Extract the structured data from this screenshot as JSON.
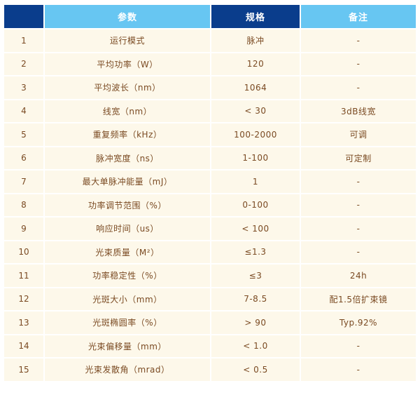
{
  "table": {
    "headers": [
      "",
      "参数",
      "规格",
      "备注"
    ],
    "rows": [
      {
        "idx": "1",
        "param": "运行模式",
        "spec": "脉冲",
        "note": "-"
      },
      {
        "idx": "2",
        "param": "平均功率（W）",
        "spec": "120",
        "note": "-"
      },
      {
        "idx": "3",
        "param": "平均波长（nm）",
        "spec": "1064",
        "note": "-"
      },
      {
        "idx": "4",
        "param": "线宽（nm）",
        "spec": "< 30",
        "note": "3dB线宽"
      },
      {
        "idx": "5",
        "param": "重复频率（kHz）",
        "spec": "100-2000",
        "note": "可调"
      },
      {
        "idx": "6",
        "param": "脉冲宽度（ns）",
        "spec": "1-100",
        "note": "可定制"
      },
      {
        "idx": "7",
        "param": "最大单脉冲能量（mJ）",
        "spec": "1",
        "note": "-"
      },
      {
        "idx": "8",
        "param": "功率调节范围（%）",
        "spec": "0-100",
        "note": "-"
      },
      {
        "idx": "9",
        "param": "响应时间（us）",
        "spec": "< 100",
        "note": "-"
      },
      {
        "idx": "10",
        "param": "光束质量（M²）",
        "spec": "≤1.3",
        "note": "-"
      },
      {
        "idx": "11",
        "param": "功率稳定性（%）",
        "spec": "≤3",
        "note": "24h"
      },
      {
        "idx": "12",
        "param": "光斑大小（mm）",
        "spec": "7-8.5",
        "note": "配1.5倍扩束镜"
      },
      {
        "idx": "13",
        "param": "光斑椭圆率（%）",
        "spec": "> 90",
        "note": "Typ.92%"
      },
      {
        "idx": "14",
        "param": "光束偏移量（mm）",
        "spec": "< 1.0",
        "note": "-"
      },
      {
        "idx": "15",
        "param": "光束发散角（mrad）",
        "spec": "< 0.5",
        "note": "-"
      }
    ]
  },
  "colors": {
    "header_dark": "#0a3d8c",
    "header_light": "#67c6f2",
    "cell_background": "#fdf8ea",
    "cell_text": "#7a4a22"
  }
}
